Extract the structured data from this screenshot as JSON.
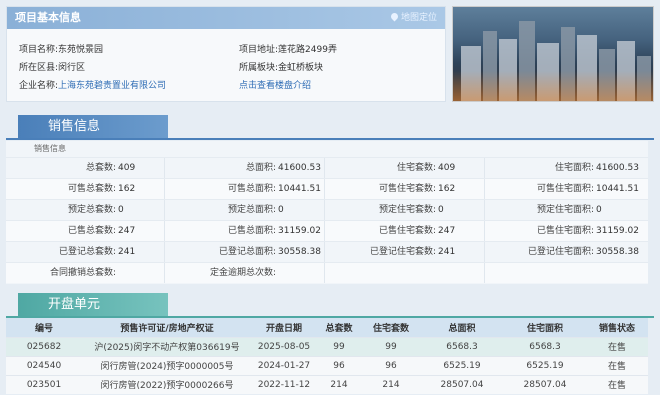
{
  "info": {
    "title": "项目基本信息",
    "map_link": "地图定位",
    "project_name_label": "项目名称:",
    "project_name": "东苑悦景园",
    "district_label": "所在区县:",
    "district": "闵行区",
    "company_label": "企业名称:",
    "company": "上海东苑碧贵置业有限公司",
    "address_label": "项目地址:",
    "address": "莲花路2499弄",
    "plate_label": "所属板块:",
    "plate": "金虹桥板块",
    "intro_link": "点击查看楼盘介绍"
  },
  "sales": {
    "title": "销售信息",
    "subtitle": "销售信息",
    "rows": [
      [
        {
          "l": "总套数:",
          "v": "409"
        },
        {
          "l": "总面积:",
          "v": "41600.53"
        },
        {
          "l": "住宅套数:",
          "v": "409"
        },
        {
          "l": "住宅面积:",
          "v": "41600.53"
        }
      ],
      [
        {
          "l": "可售总套数:",
          "v": "162"
        },
        {
          "l": "可售总面积:",
          "v": "10441.51"
        },
        {
          "l": "可售住宅套数:",
          "v": "162"
        },
        {
          "l": "可售住宅面积:",
          "v": "10441.51"
        }
      ],
      [
        {
          "l": "预定总套数:",
          "v": "0"
        },
        {
          "l": "预定总面积:",
          "v": "0"
        },
        {
          "l": "预定住宅套数:",
          "v": "0"
        },
        {
          "l": "预定住宅面积:",
          "v": "0"
        }
      ],
      [
        {
          "l": "已售总套数:",
          "v": "247"
        },
        {
          "l": "已售总面积:",
          "v": "31159.02"
        },
        {
          "l": "已售住宅套数:",
          "v": "247"
        },
        {
          "l": "已售住宅面积:",
          "v": "31159.02"
        }
      ],
      [
        {
          "l": "已登记总套数:",
          "v": "241"
        },
        {
          "l": "已登记总面积:",
          "v": "30558.38"
        },
        {
          "l": "已登记住宅套数:",
          "v": "241"
        },
        {
          "l": "已登记住宅面积:",
          "v": "30558.38"
        }
      ],
      [
        {
          "l": "合同撤销总套数:",
          "v": ""
        },
        {
          "l": "定金逾期总次数:",
          "v": ""
        }
      ]
    ]
  },
  "open_units": {
    "title": "开盘单元",
    "columns": [
      "编号",
      "预售许可证/房地产权证",
      "开盘日期",
      "总套数",
      "住宅套数",
      "总面积",
      "住宅面积",
      "销售状态"
    ],
    "rows": [
      [
        "025682",
        "沪(2025)闵字不动产权第036619号",
        "2025-08-05",
        "99",
        "99",
        "6568.3",
        "6568.3",
        "在售"
      ],
      [
        "024540",
        "闵行房管(2024)预字0000005号",
        "2024-01-27",
        "96",
        "96",
        "6525.19",
        "6525.19",
        "在售"
      ],
      [
        "023501",
        "闵行房管(2022)预字0000266号",
        "2022-11-12",
        "214",
        "214",
        "28507.04",
        "28507.04",
        "在售"
      ]
    ]
  },
  "colors": {
    "sales_tab": "#4a7fb9",
    "open_tab": "#4fa8a3",
    "status_green": "#2c9a3b",
    "link_blue": "#2f6db5"
  }
}
